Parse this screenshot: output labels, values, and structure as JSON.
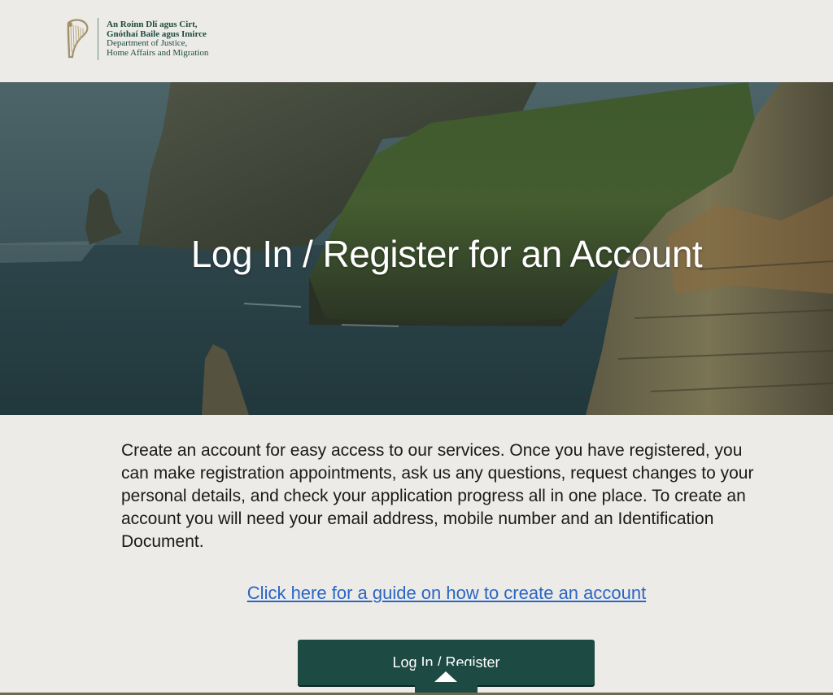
{
  "header": {
    "logo_lines": [
      "An Roinn Dlí agus Cirt,",
      "Gnóthaí Baile agus Imirce",
      "Department of Justice,",
      "Home Affairs and Migration"
    ]
  },
  "hero": {
    "title": "Log In / Register for an Account"
  },
  "main": {
    "intro": "Create an account for easy access to our services. Once you have registered, you can make registration appointments, ask us any questions, request changes to your personal details, and check your application progress all in one place. To create an account you will need your email address, mobile number and an Identification Document.",
    "guide_link": "Click here for a guide on how to create an account",
    "login_button": "Log In / Register"
  },
  "colors": {
    "page_bg": "#ecebe7",
    "brand_green": "#1d4a42",
    "link_blue": "#2b66c4"
  },
  "icons": {
    "logo": "harp-icon",
    "scroll": "scroll-to-top-icon"
  }
}
